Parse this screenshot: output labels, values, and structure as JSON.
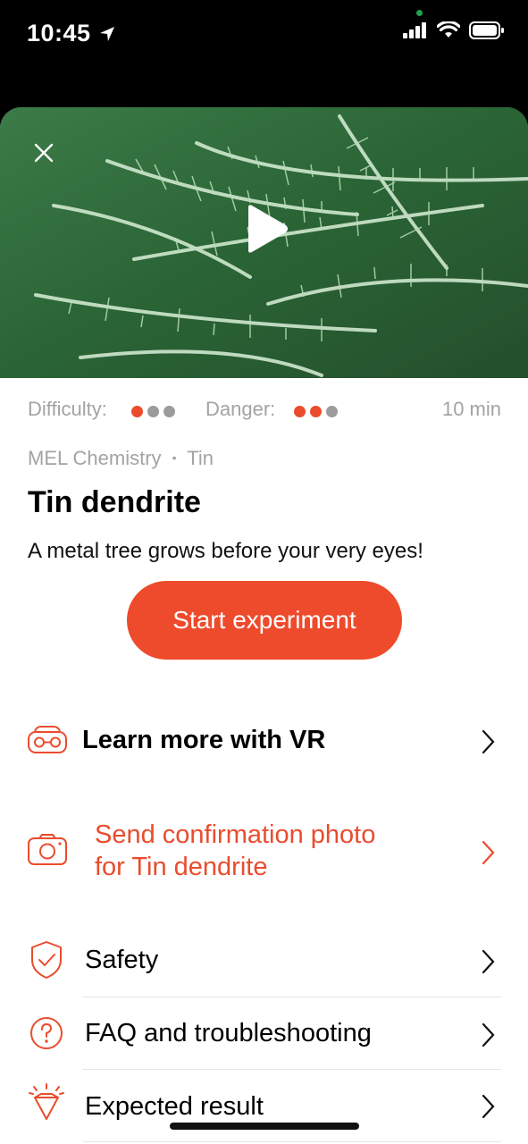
{
  "status_bar": {
    "time": "10:45"
  },
  "hero": {
    "video_label": "play-video"
  },
  "meta": {
    "difficulty_label": "Difficulty:",
    "difficulty_level": 1,
    "danger_label": "Danger:",
    "danger_level": 2,
    "max_level": 3,
    "duration": "10 min"
  },
  "breadcrumb": {
    "brand": "MEL Chemistry",
    "separator": "•",
    "topic": "Tin"
  },
  "title": "Tin dendrite",
  "subtitle": "A metal tree grows before your very eyes!",
  "start_button": "Start experiment",
  "menu": {
    "vr": "Learn more with VR",
    "photo_line1": "Send confirmation photo",
    "photo_line2": "for Tin dendrite",
    "safety": "Safety",
    "faq": "FAQ and troubleshooting",
    "expected": "Expected result"
  },
  "colors": {
    "accent": "#EE4A2C",
    "muted": "#A3A3A3",
    "dot_off": "#9B9B9B"
  }
}
